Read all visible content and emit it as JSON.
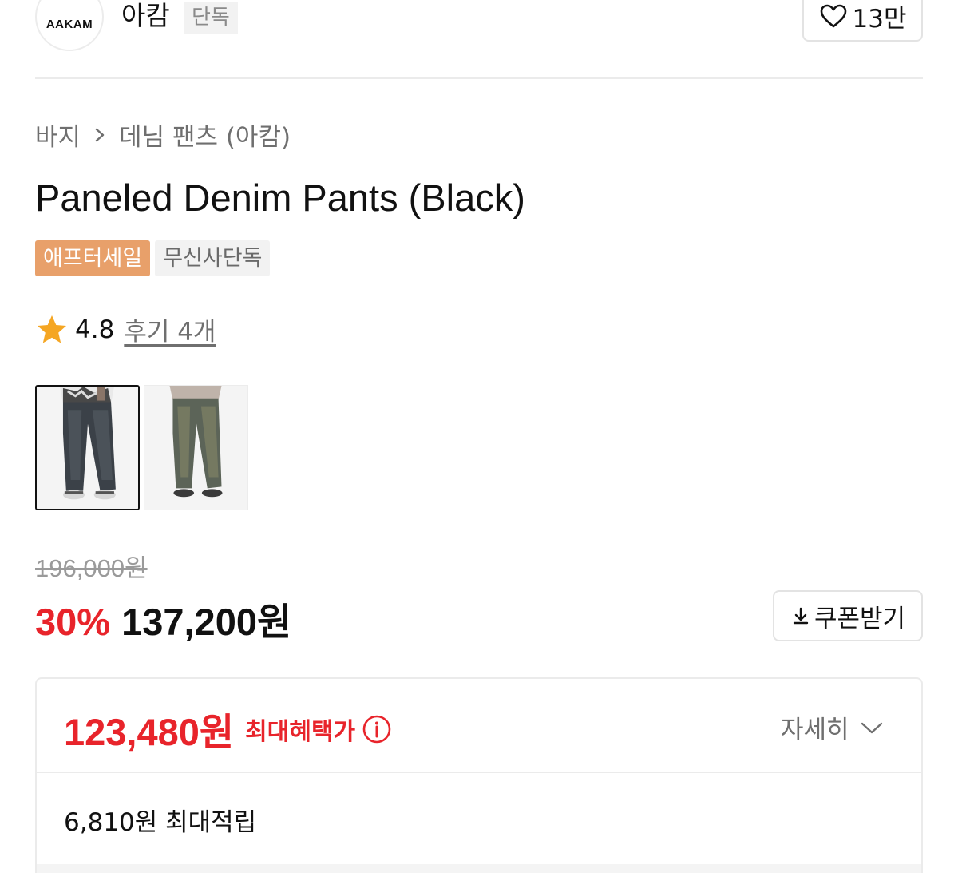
{
  "header": {
    "brand_logo_text": "AAKAM",
    "brand_name": "아캄",
    "brand_badge": "단독",
    "like_count": "13만"
  },
  "breadcrumb": {
    "category": "바지",
    "subcategory": "데님 팬츠 (아캄)"
  },
  "product": {
    "title": "Paneled Denim Pants (Black)",
    "tags": [
      "애프터세일",
      "무신사단독"
    ],
    "rating": "4.8",
    "review_link": "후기 4개",
    "thumbnail_count": 2
  },
  "price": {
    "original": "196,000원",
    "discount": "30%",
    "sale": "137,200원",
    "coupon_label": "쿠폰받기"
  },
  "benefit": {
    "max_price": "123,480원",
    "max_label": "최대혜택가",
    "details_label": "자세히",
    "points": "6,810원 최대적립"
  },
  "colors": {
    "accent_red": "#e8242b",
    "sale_tag": "#e8a06a",
    "star": "#f5a623"
  },
  "icons": [
    "heart-icon",
    "chevron-right-icon",
    "star-icon",
    "download-icon",
    "info-icon",
    "chevron-down-icon"
  ]
}
